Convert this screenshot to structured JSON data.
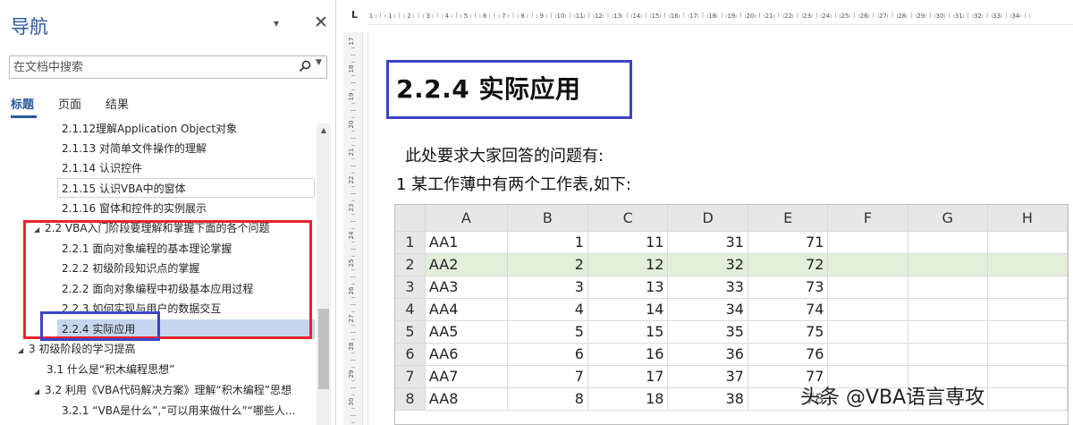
{
  "nav": {
    "title": "导航",
    "dropdown_glyph": "▾",
    "close_glyph": "✕",
    "search_placeholder": "在文档中搜索",
    "tabs": [
      {
        "label": "标题",
        "active": true
      },
      {
        "label": "页面",
        "active": false
      },
      {
        "label": "结果",
        "active": false
      }
    ],
    "tree": [
      {
        "label": "2.1.12理解Application Object对象",
        "level": 3
      },
      {
        "label": "2.1.13 对简单文件操作的理解",
        "level": 3
      },
      {
        "label": "2.1.14 认识控件",
        "level": 3
      },
      {
        "label": "2.1.15  认识VBA中的窗体",
        "level": 3,
        "boxed": true
      },
      {
        "label": "2.1.16 窗体和控件的实例展示",
        "level": 3
      },
      {
        "label": "2.2 VBA入门阶段要理解和掌握下面的各个问题",
        "level": 2,
        "expanded": true
      },
      {
        "label": "2.2.1 面向对象编程的基本理论掌握",
        "level": 3
      },
      {
        "label": "2.2.2  初级阶段知识点的掌握",
        "level": 3
      },
      {
        "label": "2.2.2 面向对象编程中初级基本应用过程",
        "level": 3
      },
      {
        "label": "2.2.3 如何实现与用户的数据交互",
        "level": 3
      },
      {
        "label": "2.2.4 实际应用",
        "level": 3,
        "selected": true
      },
      {
        "label": "3 初级阶段的学习提高",
        "level": 1,
        "expanded": true
      },
      {
        "label": "3.1  什么是“积木编程思想”",
        "level": 2
      },
      {
        "label": "3.2 利用《VBA代码解决方案》理解“积木编程”思想",
        "level": 2,
        "expanded": true
      },
      {
        "label": "3.2.1 “VBA是什么”,“可以用来做什么”“哪些人...",
        "level": 3
      }
    ]
  },
  "doc": {
    "heading": "2.2.4  实际应用",
    "para1": "此处要求大家回答的问题有:",
    "para2": "1   某工作薄中有两个工作表,如下:",
    "sheet": {
      "columns": [
        "A",
        "B",
        "C",
        "D",
        "E",
        "F",
        "G",
        "H"
      ],
      "rows": [
        {
          "n": "1",
          "cells": [
            "AA1",
            "1",
            "11",
            "31",
            "71"
          ]
        },
        {
          "n": "2",
          "cells": [
            "AA2",
            "2",
            "12",
            "32",
            "72"
          ],
          "highlight": true
        },
        {
          "n": "3",
          "cells": [
            "AA3",
            "3",
            "13",
            "33",
            "73"
          ]
        },
        {
          "n": "4",
          "cells": [
            "AA4",
            "4",
            "14",
            "34",
            "74"
          ]
        },
        {
          "n": "5",
          "cells": [
            "AA5",
            "5",
            "15",
            "35",
            "75"
          ]
        },
        {
          "n": "6",
          "cells": [
            "AA6",
            "6",
            "16",
            "36",
            "76"
          ]
        },
        {
          "n": "7",
          "cells": [
            "AA7",
            "7",
            "17",
            "37",
            "77"
          ]
        },
        {
          "n": "8",
          "cells": [
            "AA8",
            "8",
            "18",
            "38",
            "78"
          ]
        }
      ]
    },
    "h_ruler_labels": [
      "1",
      "1",
      "2",
      "3",
      "4",
      "5",
      "6",
      "7",
      "8",
      "9",
      "10",
      "11",
      "12",
      "13",
      "14",
      "15",
      "16",
      "17",
      "18",
      "19",
      "20",
      "21",
      "22",
      "23",
      "24",
      "25",
      "26",
      "27",
      "28",
      "29",
      "30",
      "31",
      "32",
      "33",
      "34"
    ],
    "v_ruler_labels": [
      "17",
      "18",
      "19",
      "20",
      "21",
      "22",
      "23",
      "24",
      "25",
      "26",
      "27",
      "28",
      "29",
      "30"
    ]
  },
  "watermark": "头条 @VBA语言専攻",
  "colors": {
    "accent": "#2b579a",
    "mark_red": "#e8222e",
    "mark_blue": "#3b44c6",
    "row_highlight": "#e2efda"
  }
}
